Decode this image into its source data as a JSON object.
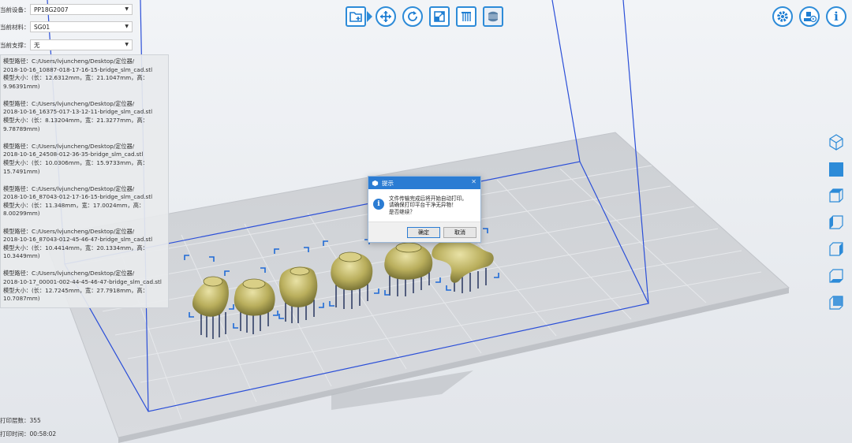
{
  "settings": {
    "device_label": "当前设备：",
    "device_value": "PP18G2007",
    "material_label": "当前材料：",
    "material_value": "SG01",
    "support_label": "当前支撑：",
    "support_value": "无"
  },
  "models": [
    {
      "path1": "模型路径：C:/Users/lvjuncheng/Desktop/定位器/",
      "path2": "2018-10-16_10887-018-17-16-15-bridge_slm_cad.stl",
      "size1": "模型大小：(长：12.6312mm，宽：21.1047mm，高：",
      "size2": "9.96391mm)"
    },
    {
      "path1": "模型路径：C:/Users/lvjuncheng/Desktop/定位器/",
      "path2": "2018-10-16_16375-017-13-12-11-bridge_slm_cad.stl",
      "size1": "模型大小：(长：8.13204mm，宽：21.3277mm，高：",
      "size2": "9.78789mm)"
    },
    {
      "path1": "模型路径：C:/Users/lvjuncheng/Desktop/定位器/",
      "path2": "2018-10-16_24508-012-36-35-bridge_slm_cad.stl",
      "size1": "模型大小：(长：10.0306mm，宽：15.9733mm，高：",
      "size2": "15.7491mm)"
    },
    {
      "path1": "模型路径：C:/Users/lvjuncheng/Desktop/定位器/",
      "path2": "2018-10-16_87043-012-17-16-15-bridge_slm_cad.stl",
      "size1": "模型大小：(长：11.348mm，宽：17.0024mm，高：",
      "size2": "8.00299mm)"
    },
    {
      "path1": "模型路径：C:/Users/lvjuncheng/Desktop/定位器/",
      "path2": "2018-10-16_87043-012-45-46-47-bridge_slm_cad.stl",
      "size1": "模型大小：(长：10.4414mm，宽：20.1334mm，高：",
      "size2": "10.3449mm)"
    },
    {
      "path1": "模型路径：C:/Users/lvjuncheng/Desktop/定位器/",
      "path2": "2018-10-17_00001-002-44-45-46-47-bridge_slm_cad.stl",
      "size1": "模型大小：(长：12.7245mm，宽：27.7918mm，高：",
      "size2": "10.7087mm)"
    }
  ],
  "toolbar": {
    "icons": [
      "add-model-icon",
      "move-icon",
      "rotate-icon",
      "scale-icon",
      "support-icon",
      "slice-icon"
    ],
    "right_icons": [
      "settings-icon",
      "print-icon",
      "info-icon"
    ],
    "view_icons": [
      "view-3d-icon",
      "view-front-icon",
      "view-top-icon",
      "view-left-icon",
      "view-right-icon",
      "view-bottom-icon",
      "view-back-icon"
    ],
    "accent": "#2d8bd8"
  },
  "dialog": {
    "title": "提示",
    "line1": "文件传输完成后将开始自动打印。",
    "line2": "请确保打印平台干净无异物！",
    "line3": "是否继续？",
    "ok": "确定",
    "cancel": "取消",
    "close": "✕"
  },
  "status": {
    "layers_label": "打印层数：",
    "layers_value": "355",
    "time_label": "打印时间：",
    "time_value": "00:58:02"
  }
}
